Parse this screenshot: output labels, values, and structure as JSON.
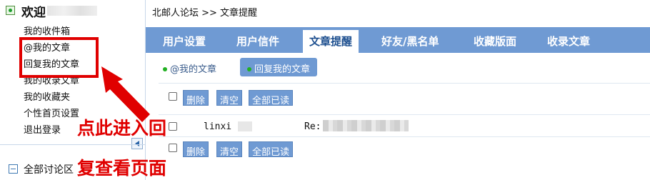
{
  "sidebar": {
    "welcome": "欢迎",
    "menu": [
      "我的收件箱",
      "@我的文章",
      "回复我的文章",
      "我的收录文章",
      "我的收藏夹",
      "个性首页设置",
      "退出登录"
    ],
    "all_discussions": "全部讨论区"
  },
  "annotation": {
    "line1": "点此进入回",
    "line2": "复查看页面",
    "color": "#e00000"
  },
  "breadcrumb": "北邮人论坛 >> 文章提醒",
  "tabs": [
    "用户设置",
    "用户信件",
    "文章提醒",
    "好友/黑名单",
    "收藏版面",
    "收录文章"
  ],
  "active_tab": "文章提醒",
  "subtabs": [
    "@我的文章",
    "回复我的文章"
  ],
  "actions": [
    "删除",
    "清空",
    "全部已读"
  ],
  "row": {
    "from": "linxi",
    "subject_prefix": "Re:"
  },
  "colors": {
    "accent": "#6f9ad3",
    "highlight": "#e00000"
  }
}
